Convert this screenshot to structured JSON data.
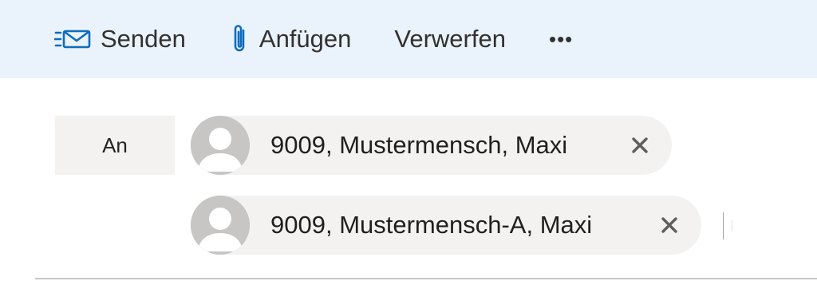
{
  "toolbar": {
    "send_label": "Senden",
    "send_icon": "send-mail-icon",
    "attach_label": "Anfügen",
    "attach_icon": "paperclip-icon",
    "discard_label": "Verwerfen",
    "more_label": "•••",
    "accent_color": "#0f6cbd",
    "background_color": "#eaf2fb"
  },
  "recipients": {
    "to_label": "An",
    "chips": [
      {
        "name": "9009, Mustermensch, Maxi",
        "avatar_icon": "person-avatar-icon",
        "remove_icon": "close-icon"
      },
      {
        "name": "9009, Mustermensch-A, Maxi",
        "avatar_icon": "person-avatar-icon",
        "remove_icon": "close-icon"
      }
    ]
  }
}
